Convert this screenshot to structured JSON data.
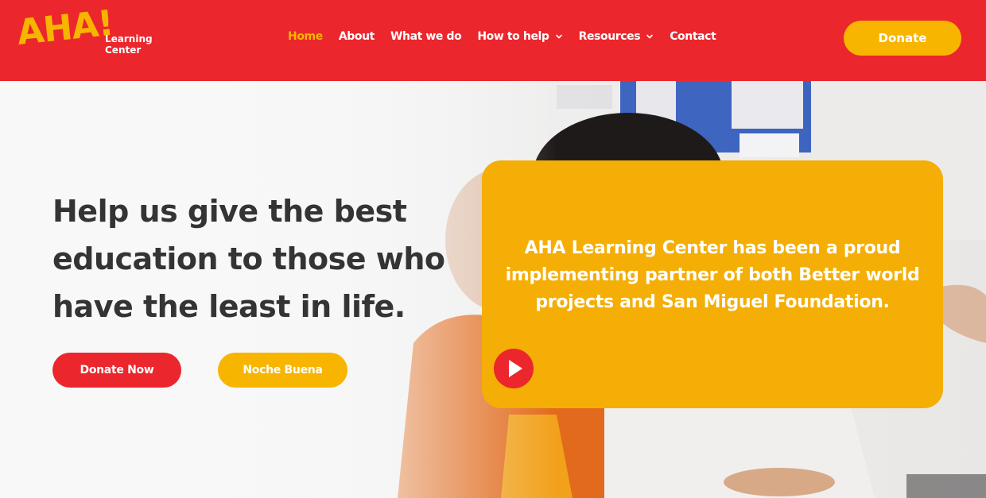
{
  "brand": {
    "logo_mark": "AHA!",
    "logo_line1": "Learning",
    "logo_line2": "Center"
  },
  "nav": {
    "items": [
      {
        "label": "Home",
        "active": true
      },
      {
        "label": "About"
      },
      {
        "label": "What we do"
      },
      {
        "label": "How to help",
        "has_dropdown": true
      },
      {
        "label": "Resources",
        "has_dropdown": true
      },
      {
        "label": "Contact"
      }
    ],
    "donate_label": "Donate"
  },
  "hero": {
    "headline": "Help us give the best education to those who have the least in life.",
    "primary_button": "Donate Now",
    "secondary_button": "Noche Buena",
    "card_text": "AHA Learning Center has been a proud implementing partner of both Better world projects and San Miguel Foundation.",
    "play_icon": "play-icon"
  },
  "colors": {
    "brand_red": "#ec262d",
    "brand_yellow": "#f7b500",
    "card_yellow": "#f4ae05",
    "headline_dark": "#343434"
  }
}
